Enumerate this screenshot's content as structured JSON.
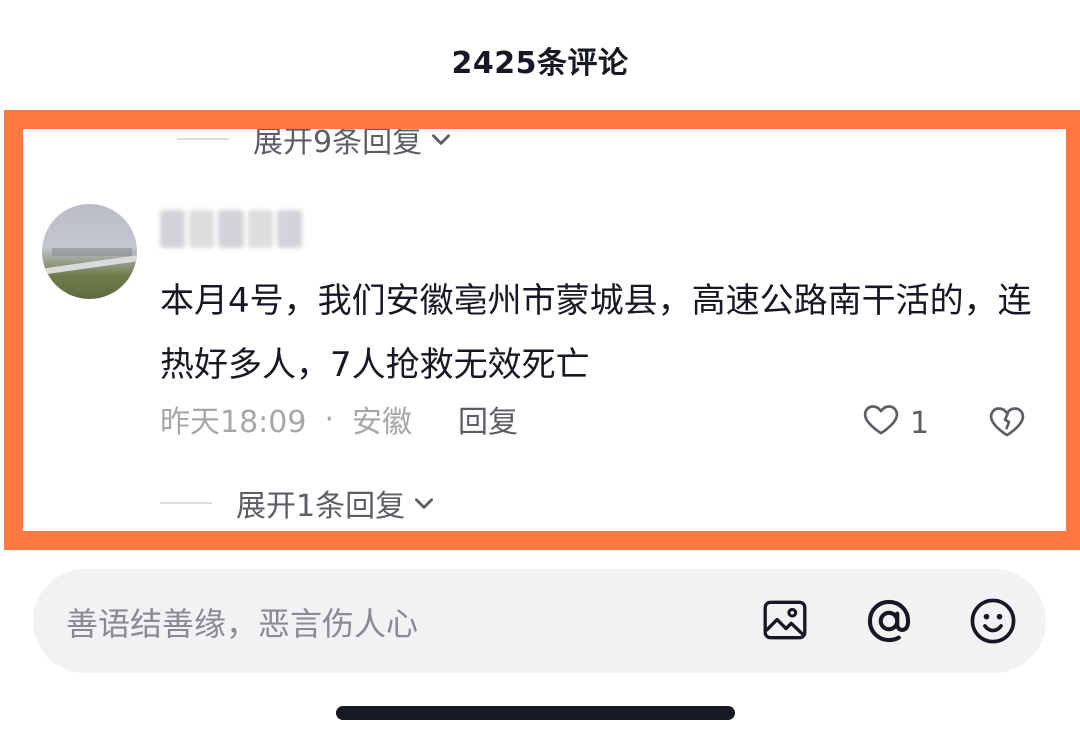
{
  "header": {
    "title": "2425条评论"
  },
  "thread": {
    "expand_top_label": "展开9条回复",
    "comment": {
      "text": "本月4号，我们安徽亳州市蒙城县，高速公路南干活的，连热好多人，7人抢救无效死亡",
      "time": "昨天18:09",
      "dot": "·",
      "location": "安徽",
      "reply_label": "回复",
      "like_count": "1"
    },
    "expand_bottom_label": "展开1条回复"
  },
  "input_bar": {
    "placeholder": "善语结善缘，恶言伤人心",
    "icons": [
      "image-icon",
      "at-icon",
      "emoji-icon"
    ]
  },
  "colors": {
    "highlight": "#ff7842",
    "text_primary": "#161823",
    "text_secondary": "#5c5e66",
    "text_muted": "#a6a7ab",
    "input_bg": "#f2f2f4"
  }
}
